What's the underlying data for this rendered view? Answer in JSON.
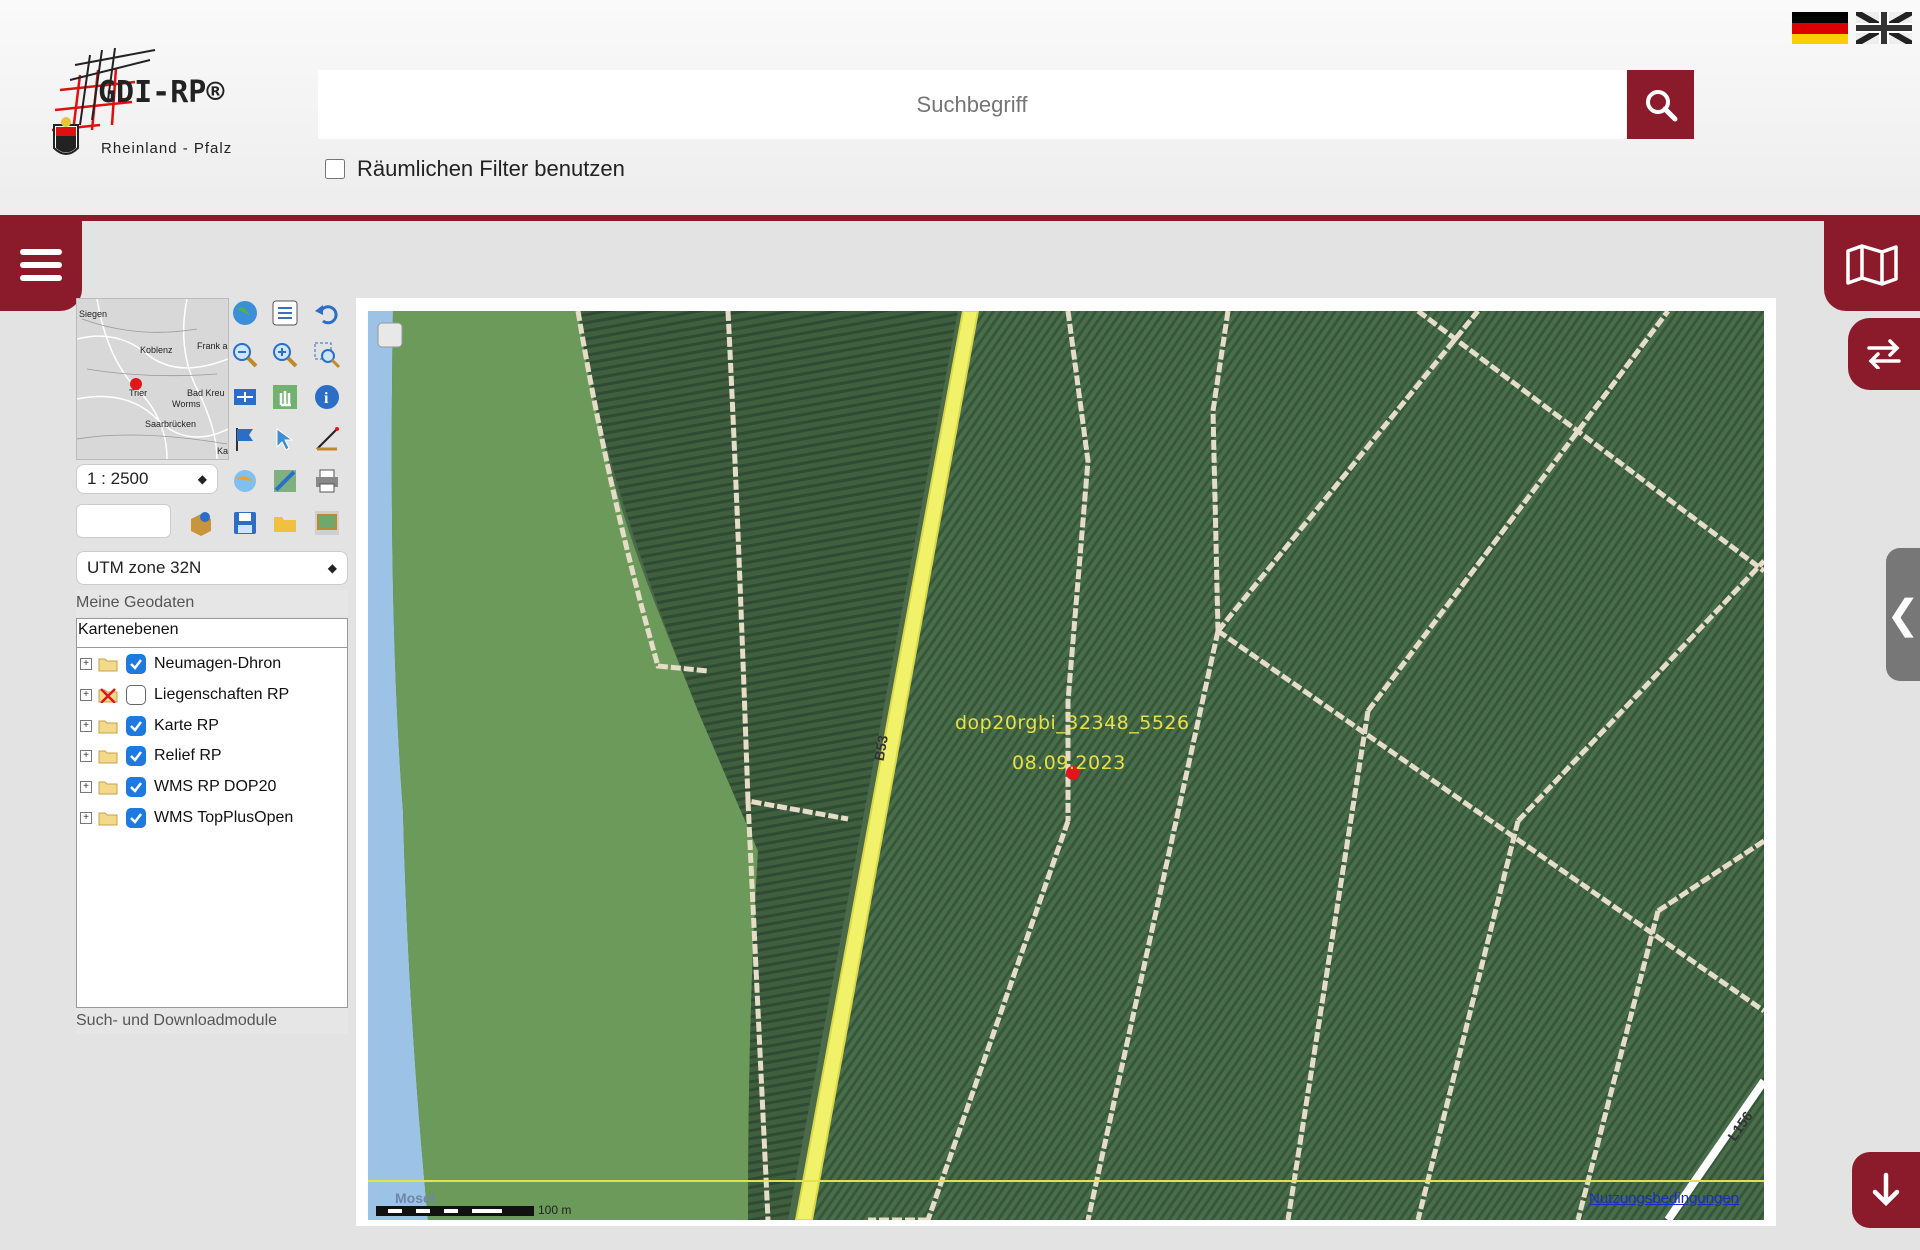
{
  "header": {
    "logo_title": "GDI-RP®",
    "logo_subtitle": "Rheinland - Pfalz",
    "search_placeholder": "Suchbegriff",
    "spatial_filter_label": "Räumlichen Filter benutzen",
    "spatial_filter_checked": false,
    "flags": [
      "flag-de-icon",
      "flag-uk-icon"
    ]
  },
  "colors": {
    "brand": "#8b1a2b",
    "checkbox": "#1e7ae0",
    "map_label": "#e8e04a"
  },
  "side_panel": {
    "overview_places": [
      "Siegen",
      "Koblenz",
      "Frank am M",
      "Trier",
      "Bad Kreu",
      "Worms",
      "Saarbrücken",
      "Ka"
    ],
    "scale": "1 : 2500",
    "crs": "UTM zone 32N",
    "sections": {
      "my_geodata": "Meine Geodaten",
      "layers": "Kartenebenen",
      "search_download": "Such- und Downloadmodule"
    },
    "layers": [
      {
        "label": "Neumagen-Dhron",
        "checked": true,
        "icon": "folder-icon"
      },
      {
        "label": "Liegenschaften RP",
        "checked": false,
        "icon": "error-x-icon"
      },
      {
        "label": "Karte RP",
        "checked": true,
        "icon": "folder-icon"
      },
      {
        "label": "Relief RP",
        "checked": true,
        "icon": "folder-icon"
      },
      {
        "label": "WMS RP DOP20",
        "checked": true,
        "icon": "folder-icon"
      },
      {
        "label": "WMS TopPlusOpen",
        "checked": true,
        "icon": "folder-icon"
      }
    ]
  },
  "map": {
    "tile_label": "dop20rgbi_32348_5526",
    "tile_date": "08.09.2023",
    "road_b53": "B53",
    "road_l156": "L156",
    "river": "Mosel",
    "scale_text": "100 m",
    "terms_link": "Nutzungsbedingungen"
  }
}
